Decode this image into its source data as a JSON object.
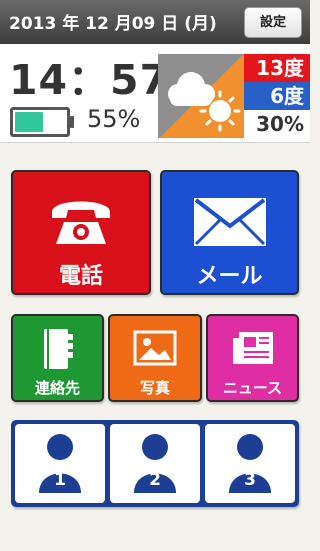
{
  "status_bar": {
    "date": "2013 年 12 月09 日 (月)",
    "settings_label": "設定"
  },
  "info_panel": {
    "time": "14：57",
    "battery_percent_label": "55%",
    "battery_level": 0.55,
    "battery_color": "#31c79a",
    "weather_icons": [
      "cloud-icon",
      "sun-icon"
    ],
    "temp_high": "13度",
    "temp_low": "6度",
    "precip_chance": "30%"
  },
  "apps": {
    "phone_label": "電話",
    "mail_label": "メール",
    "contacts_label": "連絡先",
    "photos_label": "写真",
    "news_label": "ニュース"
  },
  "speed_dial": [
    {
      "number": "1"
    },
    {
      "number": "2"
    },
    {
      "number": "3"
    }
  ],
  "colors": {
    "phone": "#d8101a",
    "mail": "#1c4fd2",
    "contacts": "#1e9833",
    "photos": "#ef6a17",
    "news": "#df2da4",
    "speed_dial": "#1d3f93",
    "temp_high": "#e4161b",
    "temp_low": "#2660c8"
  }
}
